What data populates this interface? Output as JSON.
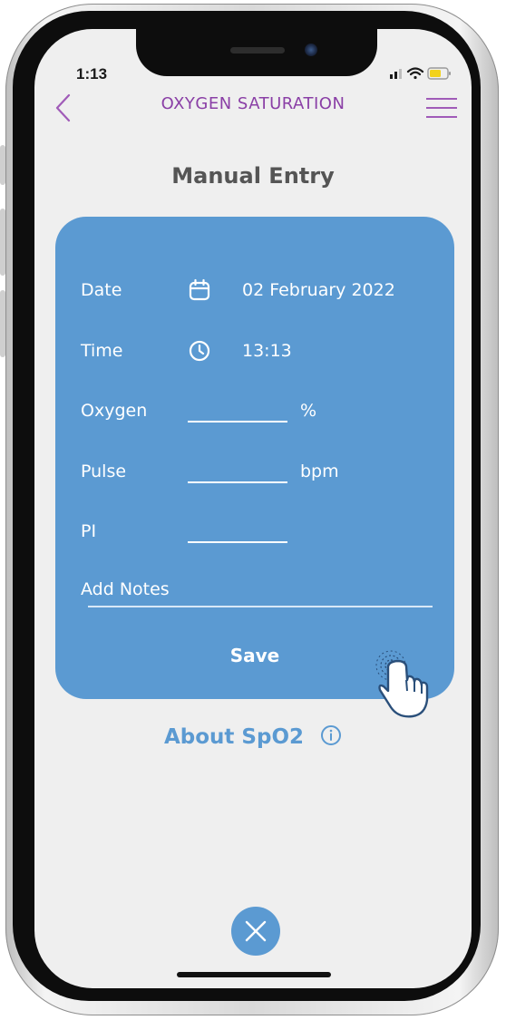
{
  "status_bar": {
    "time": "1:13"
  },
  "header": {
    "title": "OXYGEN SATURATION",
    "back_icon": "chevron-left-icon",
    "menu_icon": "hamburger-menu-icon"
  },
  "page": {
    "title": "Manual Entry"
  },
  "form": {
    "date": {
      "label": "Date",
      "value": "02 February 2022",
      "icon": "calendar-icon"
    },
    "time": {
      "label": "Time",
      "value": "13:13",
      "icon": "clock-icon"
    },
    "oxygen": {
      "label": "Oxygen",
      "value": "",
      "unit": "%"
    },
    "pulse": {
      "label": "Pulse",
      "value": "",
      "unit": "bpm"
    },
    "pi": {
      "label": "PI",
      "value": ""
    },
    "notes": {
      "label": "Add Notes",
      "value": ""
    },
    "save_label": "Save"
  },
  "about": {
    "label": "About SpO2",
    "icon": "info-icon"
  },
  "close": {
    "icon": "close-icon"
  },
  "colors": {
    "accent_blue": "#5b9ad2",
    "header_purple": "#8a3fa6",
    "title_gray": "#555555",
    "screen_bg": "#efefef"
  }
}
